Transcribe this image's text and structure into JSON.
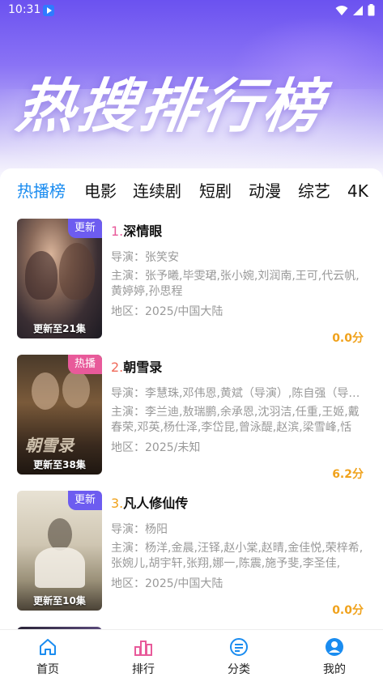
{
  "status_bar": {
    "time": "10:31"
  },
  "hero": {
    "title": "热搜排行榜"
  },
  "tabs": [
    {
      "label": "热播榜",
      "active": true
    },
    {
      "label": "电影",
      "active": false
    },
    {
      "label": "连续剧",
      "active": false
    },
    {
      "label": "短剧",
      "active": false
    },
    {
      "label": "动漫",
      "active": false
    },
    {
      "label": "综艺",
      "active": false
    },
    {
      "label": "4K",
      "active": false
    }
  ],
  "items": [
    {
      "rank": "1.",
      "rank_color": "#e85a9a",
      "title": "深情眼",
      "badge": "更新",
      "badge_type": "update",
      "episode": "更新至21集",
      "director": "导演：张笑安",
      "cast": "主演：张予曦,毕雯珺,张小婉,刘润南,王可,代云帆,黄婷婷,孙思程",
      "region": "地区：2025/中国大陆",
      "score": "0.0分"
    },
    {
      "rank": "2.",
      "rank_color": "#f06a5a",
      "title": "朝雪录",
      "badge": "热播",
      "badge_type": "hot",
      "episode": "更新至38集",
      "director": "导演：李慧珠,邓伟恩,黄斌（导演）,陈自强（导…",
      "cast": "主演：李兰迪,敖瑞鹏,余承恩,沈羽洁,任重,王姬,戴春荣,邓英,杨仕泽,李岱昆,曾泳醍,赵滨,梁雪峰,恬",
      "region": "地区：2025/未知",
      "score": "6.2分"
    },
    {
      "rank": "3.",
      "rank_color": "#f0a21c",
      "title": "凡人修仙传",
      "badge": "更新",
      "badge_type": "update",
      "episode": "更新至10集",
      "director": "导演：杨阳",
      "cast": "主演：杨洋,金晨,汪铎,赵小棠,赵晴,金佳悦,荣梓希,张婉儿,胡宇轩,张翔,娜一,陈震,施予斐,李圣佳,",
      "region": "地区：2025/中国大陆",
      "score": "0.0分"
    }
  ],
  "tabbar": [
    {
      "label": "首页",
      "icon": "home-icon"
    },
    {
      "label": "排行",
      "icon": "ranking-icon"
    },
    {
      "label": "分类",
      "icon": "category-icon"
    },
    {
      "label": "我的",
      "icon": "profile-icon"
    }
  ],
  "colors": {
    "accent": "#1a8cf0",
    "score": "#f0a21c",
    "badge_update": "#6d5cf0",
    "badge_hot": "#e85a9a"
  }
}
